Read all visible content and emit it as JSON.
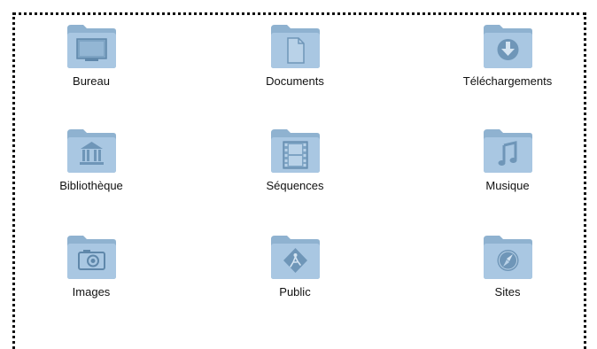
{
  "folders": [
    {
      "label": "Bureau",
      "icon": "desktop-icon"
    },
    {
      "label": "Documents",
      "icon": "document-icon"
    },
    {
      "label": "Téléchargements",
      "icon": "download-icon"
    },
    {
      "label": "Bibliothèque",
      "icon": "library-icon"
    },
    {
      "label": "Séquences",
      "icon": "film-icon"
    },
    {
      "label": "Musique",
      "icon": "music-note-icon"
    },
    {
      "label": "Images",
      "icon": "camera-icon"
    },
    {
      "label": "Public",
      "icon": "public-road-sign-icon"
    },
    {
      "label": "Sites",
      "icon": "compass-icon"
    }
  ],
  "colors": {
    "folder_back": "#8fb2d0",
    "folder_front": "#a9c7e2",
    "folder_emblem": "#6f96b8",
    "frame_border": "#111111"
  }
}
